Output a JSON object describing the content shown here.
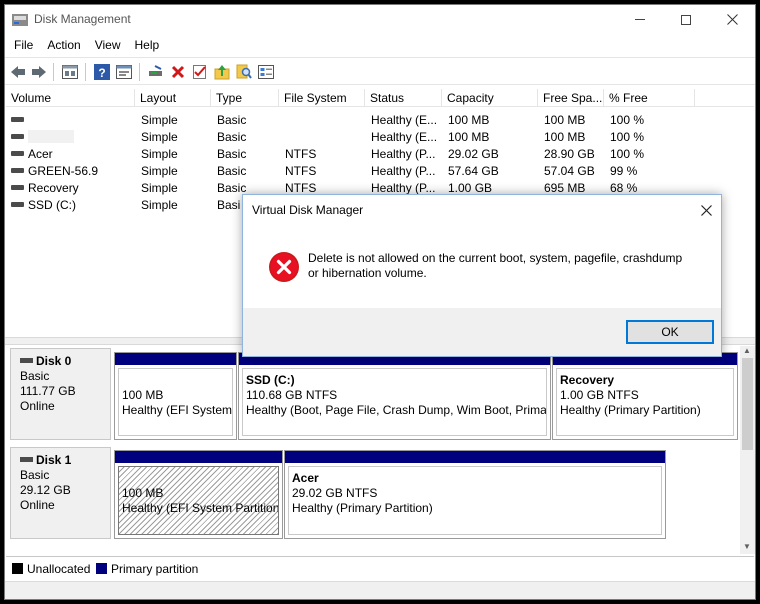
{
  "window": {
    "title": "Disk Management"
  },
  "menu": [
    "File",
    "Action",
    "View",
    "Help"
  ],
  "toolbar_icons": [
    "back-arrow-icon",
    "forward-arrow-icon",
    "properties-icon",
    "help-icon",
    "console-icon",
    "rescan-icon",
    "delete-icon",
    "check-icon",
    "up-folder-icon",
    "search-icon",
    "settings-icon"
  ],
  "columns": [
    "Volume",
    "Layout",
    "Type",
    "File System",
    "Status",
    "Capacity",
    "Free Spa...",
    "% Free"
  ],
  "volumes": [
    {
      "volume": "",
      "layout": "Simple",
      "type": "Basic",
      "fs": "",
      "status": "Healthy (E...",
      "capacity": "100 MB",
      "free": "100 MB",
      "pct": "100 %"
    },
    {
      "volume": "",
      "layout": "Simple",
      "type": "Basic",
      "fs": "",
      "status": "Healthy (E...",
      "capacity": "100 MB",
      "free": "100 MB",
      "pct": "100 %"
    },
    {
      "volume": "Acer",
      "layout": "Simple",
      "type": "Basic",
      "fs": "NTFS",
      "status": "Healthy (P...",
      "capacity": "29.02 GB",
      "free": "28.90 GB",
      "pct": "100 %"
    },
    {
      "volume": "GREEN-56.9",
      "layout": "Simple",
      "type": "Basic",
      "fs": "NTFS",
      "status": "Healthy (P...",
      "capacity": "57.64 GB",
      "free": "57.04 GB",
      "pct": "99 %"
    },
    {
      "volume": "Recovery",
      "layout": "Simple",
      "type": "Basic",
      "fs": "NTFS",
      "status": "Healthy (P...",
      "capacity": "1.00 GB",
      "free": "695 MB",
      "pct": "68 %"
    },
    {
      "volume": "SSD (C:)",
      "layout": "Simple",
      "type": "Basi",
      "fs": "",
      "status": "",
      "capacity": "",
      "free": "",
      "pct": ""
    }
  ],
  "disks": [
    {
      "name": "Disk 0",
      "type": "Basic",
      "size": "111.77 GB",
      "state": "Online",
      "partitions": [
        {
          "name": "",
          "line1": "100 MB",
          "line2": "Healthy (EFI System"
        },
        {
          "name": "SSD  (C:)",
          "line1": "110.68 GB NTFS",
          "line2": "Healthy (Boot, Page File, Crash Dump, Wim Boot, Primar"
        },
        {
          "name": "Recovery",
          "line1": "1.00 GB NTFS",
          "line2": "Healthy (Primary Partition)"
        }
      ]
    },
    {
      "name": "Disk 1",
      "type": "Basic",
      "size": "29.12 GB",
      "state": "Online",
      "partitions": [
        {
          "name": "",
          "line1": "100 MB",
          "line2": "Healthy (EFI System Partition)"
        },
        {
          "name": "Acer",
          "line1": "29.02 GB NTFS",
          "line2": "Healthy (Primary Partition)"
        }
      ]
    }
  ],
  "legend": [
    {
      "label": "Unallocated",
      "color": "#000000"
    },
    {
      "label": "Primary partition",
      "color": "#00007f"
    }
  ],
  "dialog": {
    "title": "Virtual Disk Manager",
    "message_line1": "Delete is not allowed on the current boot, system, pagefile, crashdump",
    "message_line2": "or hibernation volume.",
    "ok_label": "OK",
    "icon": "error-icon"
  },
  "colors": {
    "partition_bar": "#00007f",
    "error_red": "#e81123",
    "ok_border": "#0078d7"
  }
}
